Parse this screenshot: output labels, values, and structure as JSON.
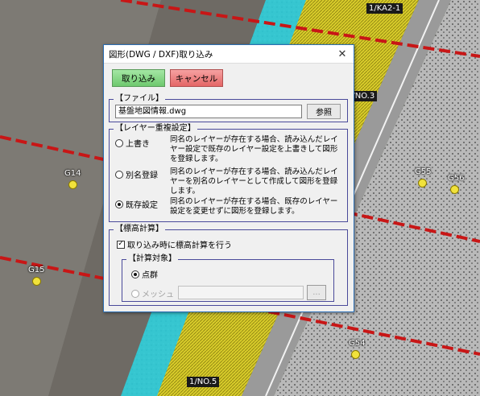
{
  "map": {
    "labels": {
      "ka2": "1/KA2-1",
      "no3": "1/NO.3",
      "no5": "1/NO.5",
      "g14": "G14",
      "g15": "G15",
      "g55": "G55",
      "g56": "G56",
      "g54": "G54"
    }
  },
  "dialog": {
    "title": "図形(DWG / DXF)取り込み",
    "close": "✕",
    "import_button": "取り込み",
    "cancel_button": "キャンセル",
    "file_group": {
      "title": "【ファイル】",
      "value": "基盤地図情報.dwg",
      "browse_button": "参照"
    },
    "layer_group": {
      "title": "【レイヤー重複設定】",
      "options": [
        {
          "label": "上書き",
          "description": "同名のレイヤーが存在する場合、読み込んだレイヤー設定で既存のレイヤー設定を上書きして図形を登録します。",
          "selected": false
        },
        {
          "label": "別名登録",
          "description": "同名のレイヤーが存在する場合、読み込んだレイヤーを別名のレイヤーとして作成して図形を登録します。",
          "selected": false
        },
        {
          "label": "既存設定",
          "description": "同名のレイヤーが存在する場合、既存のレイヤー設定を変更せずに図形を登録します。",
          "selected": true
        }
      ]
    },
    "elevation_group": {
      "title": "【標高計算】",
      "checkbox_label": "取り込み時に標高計算を行う",
      "checked": true,
      "target_group": {
        "title": "【計算対象】",
        "point_cloud_label": "点群",
        "mesh_label": "メッシュ",
        "mesh_browse": "..."
      }
    }
  }
}
